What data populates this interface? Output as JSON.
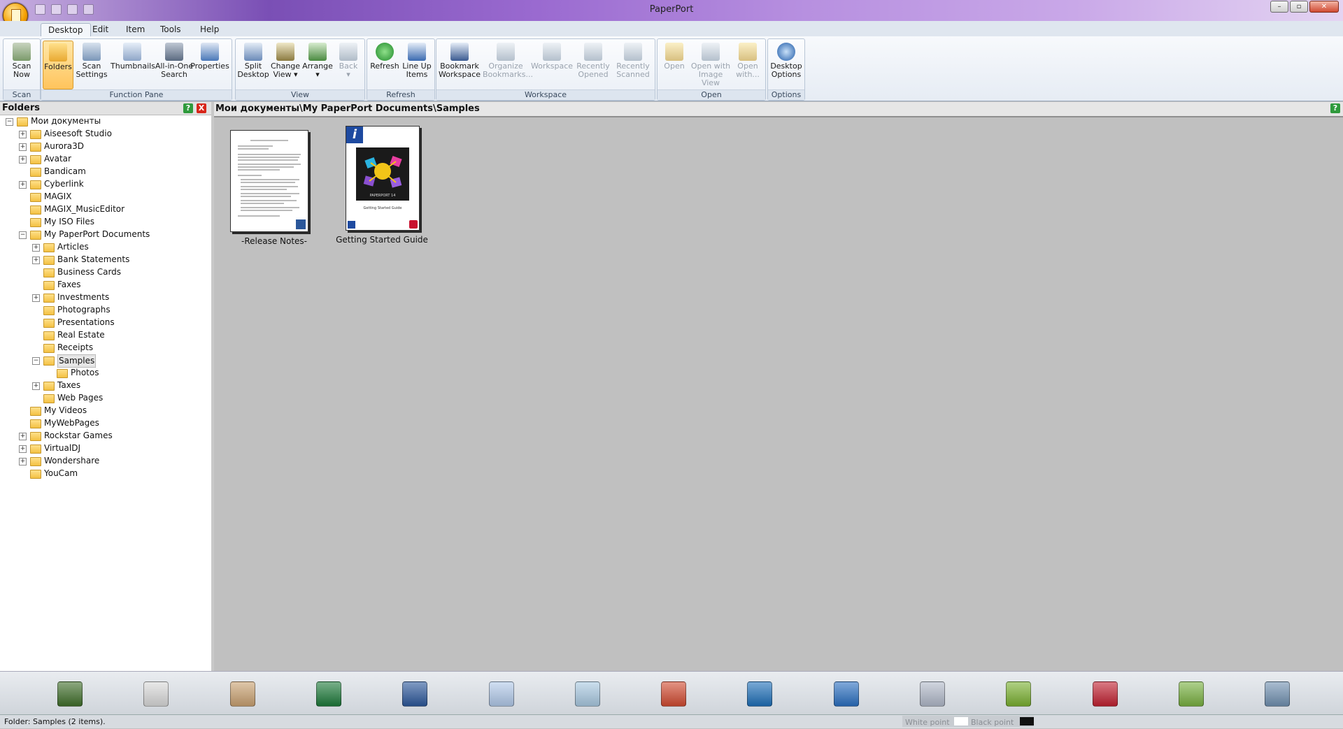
{
  "window": {
    "title": "PaperPort"
  },
  "tabs": [
    "Desktop",
    "Edit",
    "Item",
    "Tools",
    "Help"
  ],
  "ribbon": {
    "groups": {
      "scan": "Scan",
      "function_pane": "Function Pane",
      "view": "View",
      "refresh": "Refresh",
      "workspace": "Workspace",
      "open": "Open",
      "options": "Options"
    },
    "buttons": {
      "scan_now": "Scan\nNow",
      "folders": "Folders",
      "scan_settings": "Scan\nSettings",
      "thumbnails": "Thumbnails",
      "all_in_one": "All-in-One\nSearch",
      "properties": "Properties",
      "split_desktop": "Split\nDesktop",
      "change_view": "Change\nView ▾",
      "arrange": "Arrange\n▾",
      "back": "Back\n▾",
      "refresh": "Refresh",
      "line_up": "Line Up\nItems",
      "bookmark_workspace": "Bookmark\nWorkspace",
      "organize_bookmarks": "Organize\nBookmarks...",
      "workspace": "Workspace",
      "recently_opened": "Recently\nOpened",
      "recently_scanned": "Recently\nScanned",
      "open": "Open",
      "open_image_view": "Open with\nImage View",
      "open_with": "Open\nwith...",
      "desktop_options": "Desktop\nOptions"
    }
  },
  "folders_pane": {
    "title": "Folders",
    "help": "?",
    "close": "X",
    "root": "Мои документы",
    "items": [
      "Aiseesoft Studio",
      "Aurora3D",
      "Avatar",
      "Bandicam",
      "Cyberlink",
      "MAGIX",
      "MAGIX_MusicEditor",
      "My ISO Files",
      "My PaperPort Documents",
      "Articles",
      "Bank Statements",
      "Business Cards",
      "Faxes",
      "Investments",
      "Photographs",
      "Presentations",
      "Real Estate",
      "Receipts",
      "Samples",
      "Photos",
      "Taxes",
      "Web Pages",
      "My Videos",
      "MyWebPages",
      "Rockstar Games",
      "VirtualDJ",
      "Wondershare",
      "YouCam"
    ]
  },
  "main": {
    "path": "Мои документы\\My PaperPort Documents\\Samples",
    "help": "?",
    "items": [
      {
        "caption": "-Release Notes-"
      },
      {
        "caption": "Getting Started Guide",
        "cover_text": "PAPERPORT 14",
        "cover_sub": "Getting Started Guide"
      }
    ]
  },
  "sendto_bar": {
    "icons": [
      "evernote-icon",
      "printer-icon",
      "paint-icon",
      "excel-icon",
      "word-icon",
      "wordpad-icon",
      "notepad-icon",
      "powerpoint-icon",
      "browser-icon",
      "ftp-icon",
      "fax-icon",
      "hex-app-icon",
      "contacts-icon",
      "recycle-icon",
      "ocr-icon"
    ],
    "colors": [
      "#3f6e2a",
      "#d8d8d8",
      "#c8a070",
      "#1d7a3a",
      "#2b579a",
      "#b0c8e8",
      "#a8c8e0",
      "#d04a30",
      "#1e6fb8",
      "#2a6fc0",
      "#b0b8c8",
      "#7ab030",
      "#c02030",
      "#78b040",
      "#7090b0"
    ]
  },
  "status": {
    "text": "Folder: Samples (2 items).",
    "white_point": "White point",
    "black_point": "Black point"
  }
}
